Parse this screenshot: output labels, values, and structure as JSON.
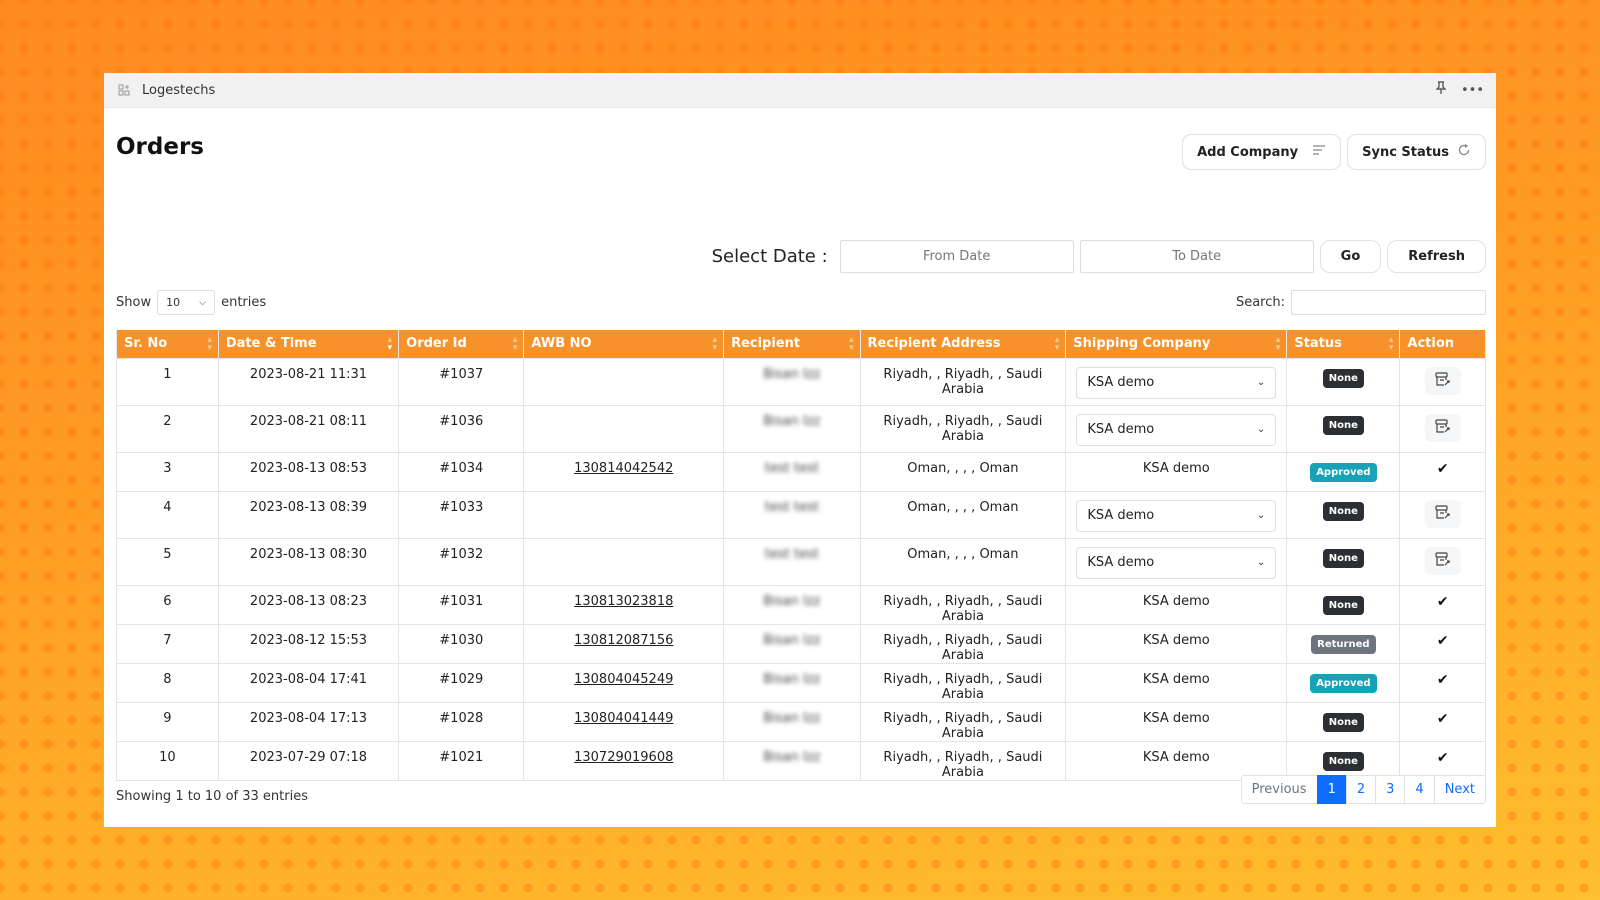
{
  "app": {
    "title": "Logestechs"
  },
  "page": {
    "title": "Orders"
  },
  "toolbar": {
    "add_company": "Add Company",
    "sync_status": "Sync Status"
  },
  "date_filter": {
    "label": "Select Date :",
    "from_placeholder": "From Date",
    "to_placeholder": "To Date",
    "go": "Go",
    "refresh": "Refresh"
  },
  "length": {
    "show": "Show",
    "value": "10",
    "entries": "entries"
  },
  "search": {
    "label": "Search:",
    "value": ""
  },
  "table": {
    "columns": [
      "Sr. No",
      "Date & Time",
      "Order Id",
      "AWB NO",
      "Recipient",
      "Recipient Address",
      "Shipping Company",
      "Status",
      "Action"
    ],
    "rows": [
      {
        "sr": "1",
        "datetime": "2023-08-21 11:31",
        "order": "#1037",
        "awb": "",
        "recipient": "Bisan Izz",
        "address": "Riyadh, , Riyadh, , Saudi Arabia",
        "company": "KSA demo",
        "company_editable": true,
        "status": "None",
        "action": "ship"
      },
      {
        "sr": "2",
        "datetime": "2023-08-21 08:11",
        "order": "#1036",
        "awb": "",
        "recipient": "Bisan Izz",
        "address": "Riyadh, , Riyadh, , Saudi Arabia",
        "company": "KSA demo",
        "company_editable": true,
        "status": "None",
        "action": "ship"
      },
      {
        "sr": "3",
        "datetime": "2023-08-13 08:53",
        "order": "#1034",
        "awb": "130814042542",
        "recipient": "test test",
        "address": "Oman, , , , Oman",
        "company": "KSA demo",
        "company_editable": false,
        "status": "Approved",
        "action": "done"
      },
      {
        "sr": "4",
        "datetime": "2023-08-13 08:39",
        "order": "#1033",
        "awb": "",
        "recipient": "test test",
        "address": "Oman, , , , Oman",
        "company": "KSA demo",
        "company_editable": true,
        "status": "None",
        "action": "ship"
      },
      {
        "sr": "5",
        "datetime": "2023-08-13 08:30",
        "order": "#1032",
        "awb": "",
        "recipient": "test test",
        "address": "Oman, , , , Oman",
        "company": "KSA demo",
        "company_editable": true,
        "status": "None",
        "action": "ship"
      },
      {
        "sr": "6",
        "datetime": "2023-08-13 08:23",
        "order": "#1031",
        "awb": "130813023818",
        "recipient": "Bisan Izz",
        "address": "Riyadh, , Riyadh, , Saudi Arabia",
        "company": "KSA demo",
        "company_editable": false,
        "status": "None",
        "action": "done"
      },
      {
        "sr": "7",
        "datetime": "2023-08-12 15:53",
        "order": "#1030",
        "awb": "130812087156",
        "recipient": "Bisan Izz",
        "address": "Riyadh, , Riyadh, , Saudi Arabia",
        "company": "KSA demo",
        "company_editable": false,
        "status": "Returned",
        "action": "done"
      },
      {
        "sr": "8",
        "datetime": "2023-08-04 17:41",
        "order": "#1029",
        "awb": "130804045249",
        "recipient": "Bisan Izz",
        "address": "Riyadh, , Riyadh, , Saudi Arabia",
        "company": "KSA demo",
        "company_editable": false,
        "status": "Approved",
        "action": "done"
      },
      {
        "sr": "9",
        "datetime": "2023-08-04 17:13",
        "order": "#1028",
        "awb": "130804041449",
        "recipient": "Bisan Izz",
        "address": "Riyadh, , Riyadh, , Saudi Arabia",
        "company": "KSA demo",
        "company_editable": false,
        "status": "None",
        "action": "done"
      },
      {
        "sr": "10",
        "datetime": "2023-07-29 07:18",
        "order": "#1021",
        "awb": "130729019608",
        "recipient": "Bisan Izz",
        "address": "Riyadh, , Riyadh, , Saudi Arabia",
        "company": "KSA demo",
        "company_editable": false,
        "status": "None",
        "action": "done"
      }
    ]
  },
  "footer": {
    "info": "Showing 1 to 10 of 33 entries",
    "pagination": {
      "previous": "Previous",
      "pages": [
        "1",
        "2",
        "3",
        "4"
      ],
      "current": "1",
      "next": "Next"
    }
  },
  "colors": {
    "accent": "#f7922a",
    "approved": "#17a2b8",
    "none": "#2b3035",
    "returned": "#6c757d",
    "link": "#0d6efd"
  },
  "icons": {
    "app": "app-grid-icon",
    "pin": "pin-icon",
    "more": "more-icon",
    "filter": "filter-lines-icon",
    "sync": "refresh-icon",
    "ship": "box-arrow-icon",
    "done": "checkmark-icon"
  }
}
